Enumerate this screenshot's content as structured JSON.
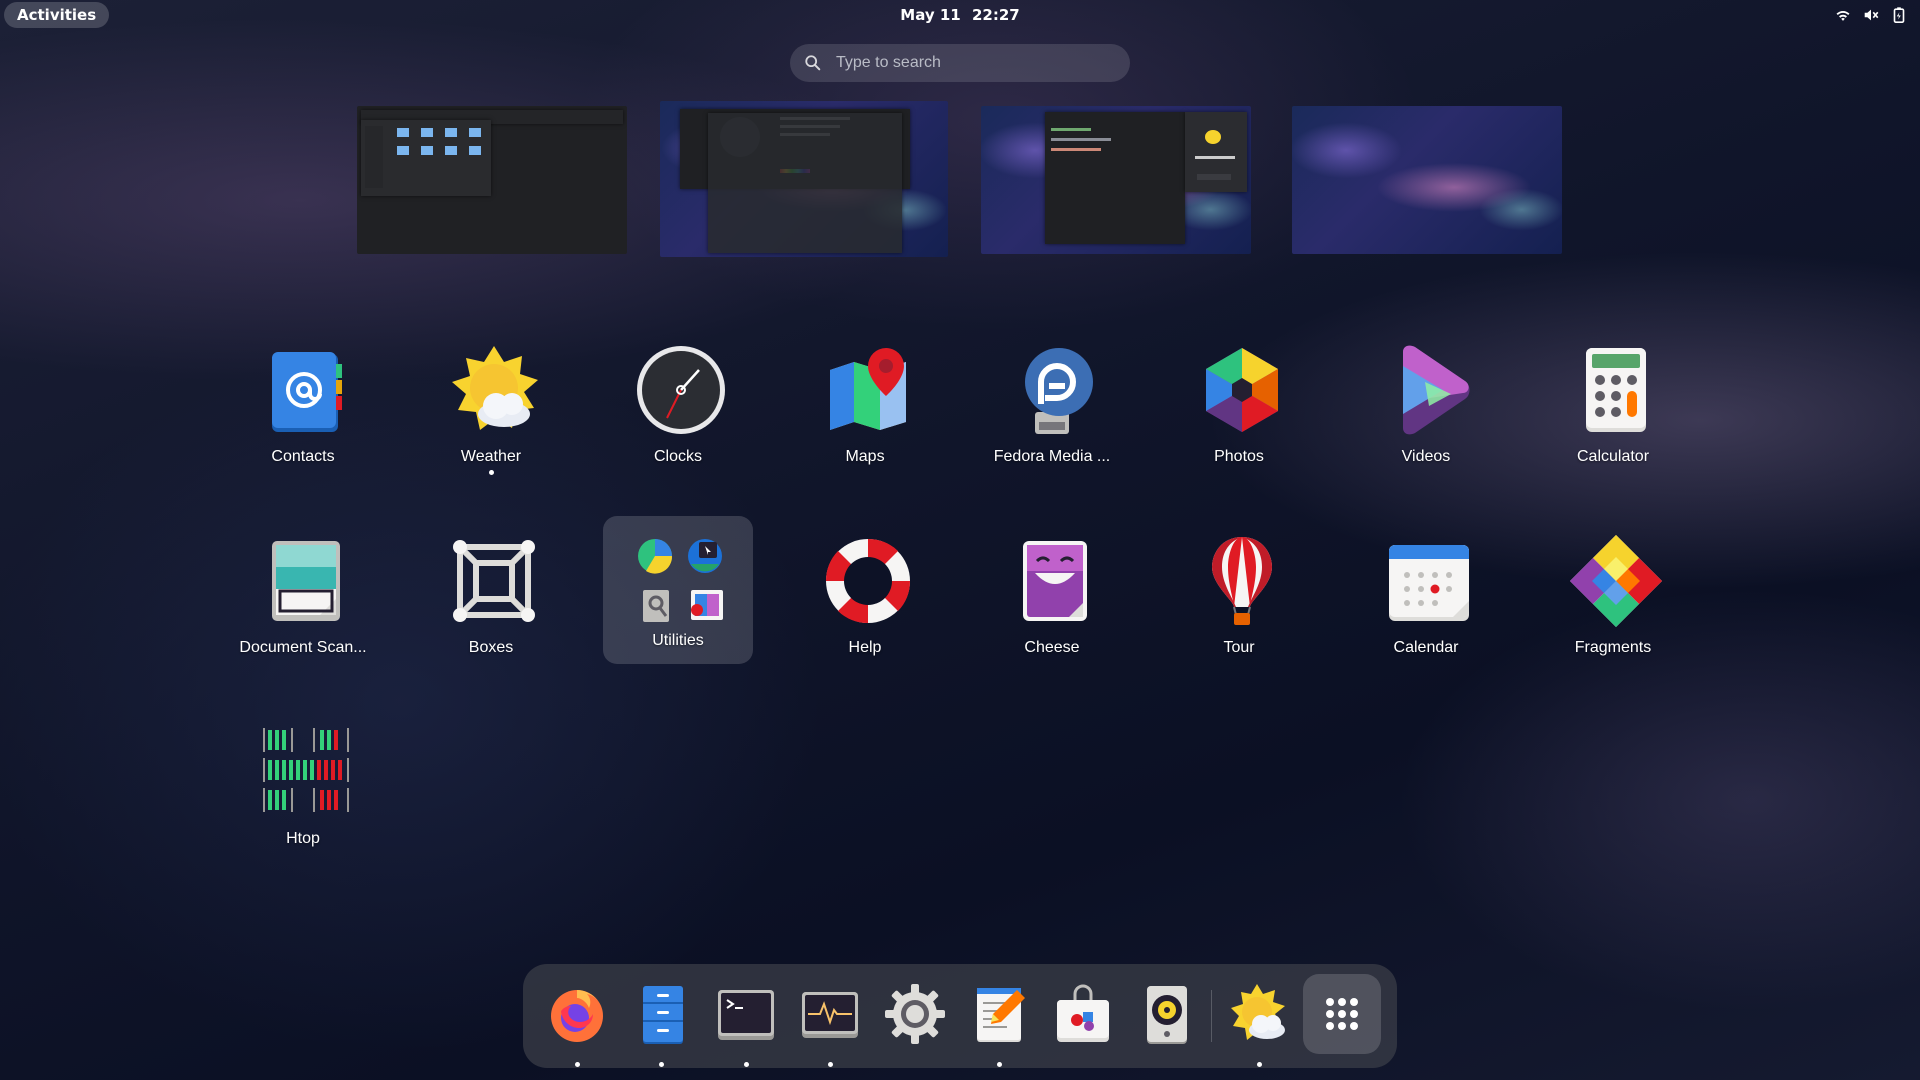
{
  "topbar": {
    "activities_label": "Activities",
    "date": "May 11",
    "time": "22:27",
    "tray_icons": [
      "wifi-icon",
      "volume-muted-icon",
      "battery-icon"
    ]
  },
  "search": {
    "placeholder": "Type to search"
  },
  "workspaces": [
    "workspace-1",
    "workspace-2",
    "workspace-3",
    "workspace-4"
  ],
  "apps": [
    {
      "label": "Contacts",
      "icon": "contacts-icon"
    },
    {
      "label": "Weather",
      "icon": "weather-icon",
      "running": true
    },
    {
      "label": "Clocks",
      "icon": "clocks-icon"
    },
    {
      "label": "Maps",
      "icon": "maps-icon"
    },
    {
      "label": "Fedora Media ...",
      "icon": "fedora-media-writer-icon"
    },
    {
      "label": "Photos",
      "icon": "photos-icon"
    },
    {
      "label": "Videos",
      "icon": "videos-icon"
    },
    {
      "label": "Calculator",
      "icon": "calculator-icon"
    },
    {
      "label": "Document Scan...",
      "icon": "document-scanner-icon"
    },
    {
      "label": "Boxes",
      "icon": "boxes-icon"
    },
    {
      "label": "Utilities",
      "icon": "utilities-folder-icon"
    },
    {
      "label": "Help",
      "icon": "help-icon"
    },
    {
      "label": "Cheese",
      "icon": "cheese-icon"
    },
    {
      "label": "Tour",
      "icon": "tour-icon"
    },
    {
      "label": "Calendar",
      "icon": "calendar-icon"
    },
    {
      "label": "Fragments",
      "icon": "fragments-icon"
    },
    {
      "label": "Htop",
      "icon": "htop-icon"
    }
  ],
  "dock": [
    {
      "icon": "firefox-icon",
      "running": true
    },
    {
      "icon": "files-icon",
      "running": true
    },
    {
      "icon": "terminal-icon",
      "running": true
    },
    {
      "icon": "system-monitor-icon",
      "running": true
    },
    {
      "icon": "settings-icon",
      "running": false
    },
    {
      "icon": "text-editor-icon",
      "running": true
    },
    {
      "icon": "software-icon",
      "running": false
    },
    {
      "icon": "rhythmbox-icon",
      "running": false
    },
    {
      "icon": "weather-icon",
      "running": true
    },
    {
      "icon": "show-apps-icon",
      "running": false
    }
  ]
}
